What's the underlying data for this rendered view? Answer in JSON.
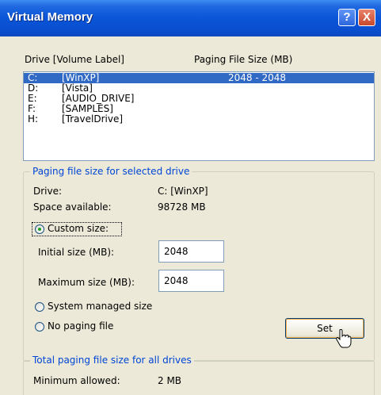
{
  "window": {
    "title": "Virtual Memory",
    "help_label": "?",
    "close_label": "X"
  },
  "drives_header": {
    "drive_col": "Drive  [Volume Label]",
    "size_col": "Paging File Size (MB)"
  },
  "drives": [
    {
      "letter": "C:",
      "label": "[WinXP]",
      "size": "2048 - 2048",
      "selected": true
    },
    {
      "letter": "D:",
      "label": "[Vista]",
      "size": "",
      "selected": false
    },
    {
      "letter": "E:",
      "label": "[AUDIO_DRIVE]",
      "size": "",
      "selected": false
    },
    {
      "letter": "F:",
      "label": "[SAMPLES]",
      "size": "",
      "selected": false
    },
    {
      "letter": "H:",
      "label": "[TravelDrive]",
      "size": "",
      "selected": false
    }
  ],
  "selected_drive_group": {
    "legend": "Paging file size for selected drive",
    "drive_label": "Drive:",
    "drive_value": "C:  [WinXP]",
    "space_label": "Space available:",
    "space_value": "98728 MB",
    "custom_label": "Custom size:",
    "initial_label": "Initial size (MB):",
    "initial_value": "2048",
    "max_label": "Maximum size (MB):",
    "max_value": "2048",
    "system_label": "System managed size",
    "no_paging_label": "No paging file",
    "set_label": "Set",
    "selected_option": "custom"
  },
  "total_group": {
    "legend": "Total paging file size for all drives",
    "min_label": "Minimum allowed:",
    "min_value": "2 MB"
  },
  "colors": {
    "title_bar": "#0a55d8",
    "selection": "#316ac5",
    "legend_text": "#0046d5"
  }
}
